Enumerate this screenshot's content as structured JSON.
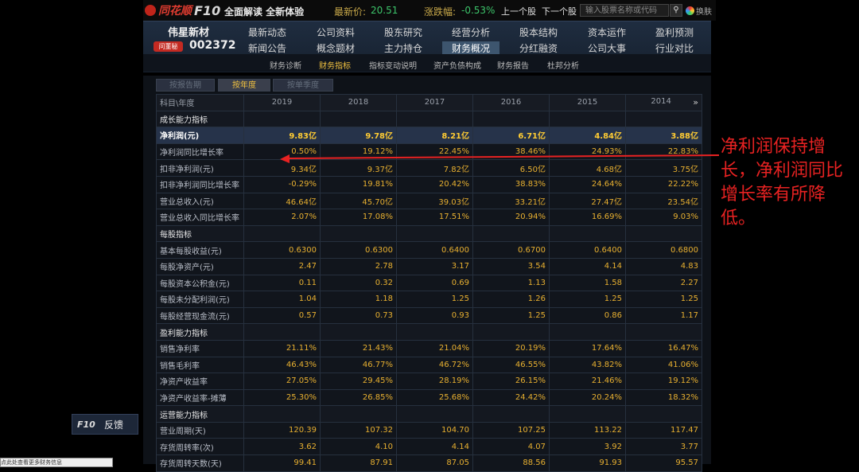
{
  "topbar": {
    "brand": "同花顺",
    "f10": "F10",
    "slogan": "全面解读 全新体验",
    "price_label": "最新价:",
    "price_value": "20.51",
    "change_label": "涨跌幅:",
    "change_value": "-0.53%",
    "prev_stock": "上一个股",
    "next_stock": "下一个股",
    "search_placeholder": "输入股票名称或代码",
    "skin_label": "换肤"
  },
  "stock": {
    "name": "伟星新材",
    "ask_label": "问董秘",
    "code": "002372"
  },
  "nav": {
    "row1": [
      "最新动态",
      "公司资料",
      "股东研究",
      "经营分析",
      "股本结构",
      "资本运作",
      "盈利预测"
    ],
    "row2": [
      "新闻公告",
      "概念题材",
      "主力持仓",
      "财务概况",
      "分红融资",
      "公司大事",
      "行业对比"
    ],
    "active": "财务概况"
  },
  "subnav": {
    "items": [
      "财务诊断",
      "财务指标",
      "指标变动说明",
      "资产负债构成",
      "财务报告",
      "杜邦分析"
    ],
    "active": "财务指标"
  },
  "period_tabs": {
    "items": [
      "按报告期",
      "按年度",
      "按单季度"
    ],
    "active": "按年度"
  },
  "table": {
    "header_label": "科目\\年度",
    "years": [
      "2019",
      "2018",
      "2017",
      "2016",
      "2015",
      "2014"
    ],
    "more_icon": "»",
    "rows": [
      {
        "type": "sec",
        "label": "成长能力指标"
      },
      {
        "type": "hl",
        "label": "净利润(元)",
        "values": [
          "9.83亿",
          "9.78亿",
          "8.21亿",
          "6.71亿",
          "4.84亿",
          "3.88亿"
        ]
      },
      {
        "type": "row",
        "label": "净利润同比增长率",
        "values": [
          "0.50%",
          "19.12%",
          "22.45%",
          "38.46%",
          "24.93%",
          "22.83%"
        ]
      },
      {
        "type": "row",
        "label": "扣非净利润(元)",
        "values": [
          "9.34亿",
          "9.37亿",
          "7.82亿",
          "6.50亿",
          "4.68亿",
          "3.75亿"
        ]
      },
      {
        "type": "row",
        "label": "扣非净利润同比增长率",
        "values": [
          "-0.29%",
          "19.81%",
          "20.42%",
          "38.83%",
          "24.64%",
          "22.22%"
        ]
      },
      {
        "type": "row",
        "label": "营业总收入(元)",
        "values": [
          "46.64亿",
          "45.70亿",
          "39.03亿",
          "33.21亿",
          "27.47亿",
          "23.54亿"
        ]
      },
      {
        "type": "row",
        "label": "营业总收入同比增长率",
        "values": [
          "2.07%",
          "17.08%",
          "17.51%",
          "20.94%",
          "16.69%",
          "9.03%"
        ]
      },
      {
        "type": "sec",
        "label": "每股指标"
      },
      {
        "type": "row",
        "label": "基本每股收益(元)",
        "values": [
          "0.6300",
          "0.6300",
          "0.6400",
          "0.6700",
          "0.6400",
          "0.6800"
        ]
      },
      {
        "type": "row",
        "label": "每股净资产(元)",
        "values": [
          "2.47",
          "2.78",
          "3.17",
          "3.54",
          "4.14",
          "4.83"
        ]
      },
      {
        "type": "row",
        "label": "每股资本公积金(元)",
        "values": [
          "0.11",
          "0.32",
          "0.69",
          "1.13",
          "1.58",
          "2.27"
        ]
      },
      {
        "type": "row",
        "label": "每股未分配利润(元)",
        "values": [
          "1.04",
          "1.18",
          "1.25",
          "1.26",
          "1.25",
          "1.25"
        ]
      },
      {
        "type": "row",
        "label": "每股经营现金流(元)",
        "values": [
          "0.57",
          "0.73",
          "0.93",
          "1.25",
          "0.86",
          "1.17"
        ]
      },
      {
        "type": "sec",
        "label": "盈利能力指标"
      },
      {
        "type": "row",
        "label": "销售净利率",
        "values": [
          "21.11%",
          "21.43%",
          "21.04%",
          "20.19%",
          "17.64%",
          "16.47%"
        ]
      },
      {
        "type": "row",
        "label": "销售毛利率",
        "values": [
          "46.43%",
          "46.77%",
          "46.72%",
          "46.55%",
          "43.82%",
          "41.06%"
        ]
      },
      {
        "type": "row",
        "label": "净资产收益率",
        "values": [
          "27.05%",
          "29.45%",
          "28.19%",
          "26.15%",
          "21.46%",
          "19.12%"
        ]
      },
      {
        "type": "row",
        "label": "净资产收益率-摊薄",
        "values": [
          "25.30%",
          "26.85%",
          "25.68%",
          "24.42%",
          "20.24%",
          "18.32%"
        ]
      },
      {
        "type": "sec",
        "label": "运营能力指标"
      },
      {
        "type": "row",
        "label": "营业周期(天)",
        "values": [
          "120.39",
          "107.32",
          "104.70",
          "107.25",
          "113.22",
          "117.47"
        ]
      },
      {
        "type": "row",
        "label": "存货周转率(次)",
        "values": [
          "3.62",
          "4.10",
          "4.14",
          "4.07",
          "3.92",
          "3.77"
        ]
      },
      {
        "type": "row",
        "label": "存货周转天数(天)",
        "values": [
          "99.41",
          "87.91",
          "87.05",
          "88.56",
          "91.93",
          "95.57"
        ]
      }
    ]
  },
  "annotation": {
    "text": "净利润保持增长，净利润同比增长率有所降低。",
    "color": "#e82222"
  },
  "feedback": {
    "icon_label": "F10",
    "label": "反馈"
  },
  "tooltip_text": "点此处查看更多财务信息"
}
